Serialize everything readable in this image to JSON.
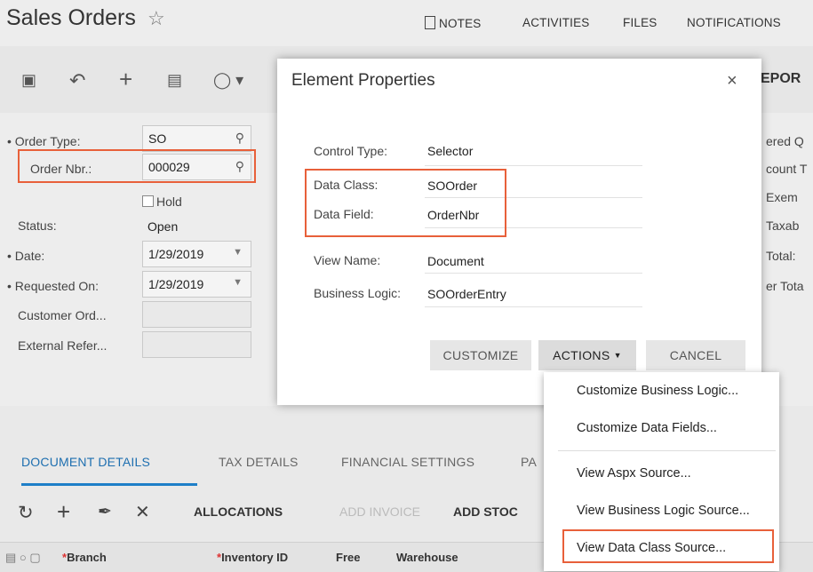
{
  "header": {
    "title": "Sales Orders",
    "star": "☆",
    "nav": [
      "NOTES",
      "ACTIVITIES",
      "FILES",
      "NOTIFICATIONS"
    ]
  },
  "toolbar": {
    "reports_partial": "EPOR"
  },
  "form": {
    "order_type_label": "Order Type:",
    "order_type_value": "SO",
    "order_nbr_label": "Order Nbr.:",
    "order_nbr_value": "000029",
    "hold_label": "Hold",
    "status_label": "Status:",
    "status_value": "Open",
    "date_label": "Date:",
    "date_value": "1/29/2019",
    "requested_on_label": "Requested On:",
    "requested_on_value": "1/29/2019",
    "customer_ord_label": "Customer Ord...",
    "external_ref_label": "External Refer...",
    "right_col": [
      "ered Q",
      "count T",
      "Exem",
      "Taxab",
      "Total:",
      "er Tota"
    ]
  },
  "dialog": {
    "title": "Element Properties",
    "close": "×",
    "properties": [
      {
        "label": "Control Type:",
        "value": "Selector"
      },
      {
        "label": "Data Class:",
        "value": "SOOrder"
      },
      {
        "label": "Data Field:",
        "value": "OrderNbr"
      },
      {
        "label": "View Name:",
        "value": "Document"
      },
      {
        "label": "Business Logic:",
        "value": "SOOrderEntry"
      }
    ],
    "buttons": {
      "customize": "CUSTOMIZE",
      "actions": "ACTIONS",
      "cancel": "CANCEL"
    }
  },
  "actions_menu": {
    "items": [
      "Customize Business Logic...",
      "Customize Data Fields...",
      "View Aspx Source...",
      "View Business Logic Source...",
      "View Data Class Source..."
    ]
  },
  "tabs": [
    "DOCUMENT DETAILS",
    "TAX DETAILS",
    "FINANCIAL SETTINGS",
    "PA"
  ],
  "grid_toolbar": {
    "allocations": "ALLOCATIONS",
    "add_invoice": "ADD INVOICE",
    "add_stock": "ADD STOC"
  },
  "grid_columns": [
    "Branch",
    "Inventory ID",
    "Free",
    "Warehouse"
  ],
  "colors": {
    "accent": "#1e7fc8",
    "highlight": "#e8603a"
  }
}
